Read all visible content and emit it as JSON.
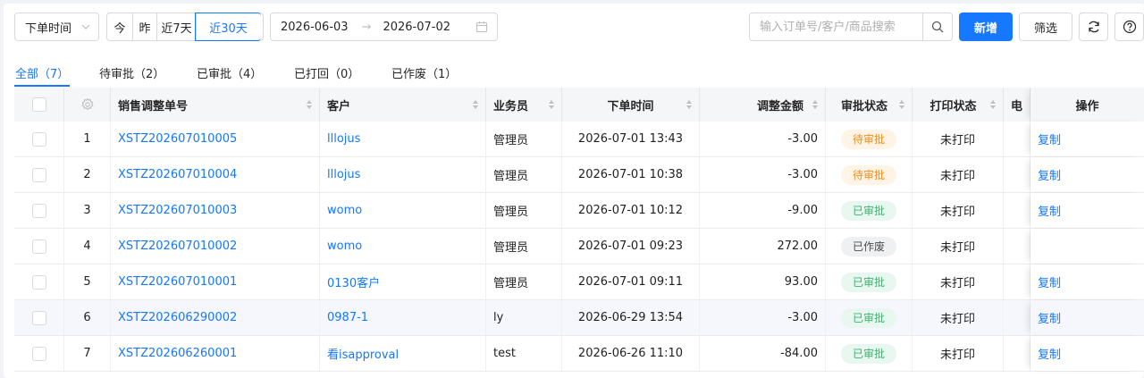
{
  "toolbar": {
    "time_select": "下单时间",
    "quick_ranges": [
      "今",
      "昨",
      "近7天",
      "近30天"
    ],
    "range_start": "2026-06-03",
    "range_arrow": "→",
    "range_end": "2026-07-02",
    "search_placeholder": "输入订单号/客户/商品搜索",
    "add_label": "新增",
    "filter_label": "筛选"
  },
  "tabs": [
    "全部（7）",
    "待审批（2）",
    "已审批（4）",
    "已打回（0）",
    "已作废（1）"
  ],
  "columns": {
    "order_no": "销售调整单号",
    "customer": "客户",
    "salesperson": "业务员",
    "order_time": "下单时间",
    "amount": "调整金额",
    "approval": "审批状态",
    "print": "打印状态",
    "e_trunc": "电",
    "action": "操作"
  },
  "rows": [
    {
      "idx": "1",
      "order_no": "XSTZ202607010005",
      "customer": "lllojus",
      "salesperson": "管理员",
      "time": "2026-07-01 13:43",
      "amount": "-3.00",
      "approval": "待审批",
      "print": "未打印",
      "action": "复制"
    },
    {
      "idx": "2",
      "order_no": "XSTZ202607010004",
      "customer": "lllojus",
      "salesperson": "管理员",
      "time": "2026-07-01 10:38",
      "amount": "-3.00",
      "approval": "待审批",
      "print": "未打印",
      "action": "复制"
    },
    {
      "idx": "3",
      "order_no": "XSTZ202607010003",
      "customer": "womo",
      "salesperson": "管理员",
      "time": "2026-07-01 10:12",
      "amount": "-9.00",
      "approval": "已审批",
      "print": "未打印",
      "action": "复制"
    },
    {
      "idx": "4",
      "order_no": "XSTZ202607010002",
      "customer": "womo",
      "salesperson": "管理员",
      "time": "2026-07-01 09:23",
      "amount": "272.00",
      "approval": "已作废",
      "print": "未打印",
      "action": ""
    },
    {
      "idx": "5",
      "order_no": "XSTZ202607010001",
      "customer": "0130客户",
      "salesperson": "管理员",
      "time": "2026-07-01 09:11",
      "amount": "93.00",
      "approval": "已审批",
      "print": "未打印",
      "action": "复制"
    },
    {
      "idx": "6",
      "order_no": "XSTZ202606290002",
      "customer": "0987-1",
      "salesperson": "ly",
      "time": "2026-06-29 13:54",
      "amount": "-3.00",
      "approval": "已审批",
      "print": "未打印",
      "action": "复制"
    },
    {
      "idx": "7",
      "order_no": "XSTZ202606260001",
      "customer": "看isapproval",
      "salesperson": "test",
      "time": "2026-06-26 11:10",
      "amount": "-84.00",
      "approval": "已审批",
      "print": "未打印",
      "action": "复制"
    }
  ],
  "status_colors": {
    "待审批": "#fa8c16",
    "已审批": "#3bb56f",
    "已作废": "#4d4d4d",
    "accent": "#1677ff"
  },
  "icons": [
    "chevron-down-icon",
    "calendar-icon",
    "search-icon",
    "refresh-icon",
    "help-icon",
    "settings-gear-icon",
    "sort-icon"
  ]
}
